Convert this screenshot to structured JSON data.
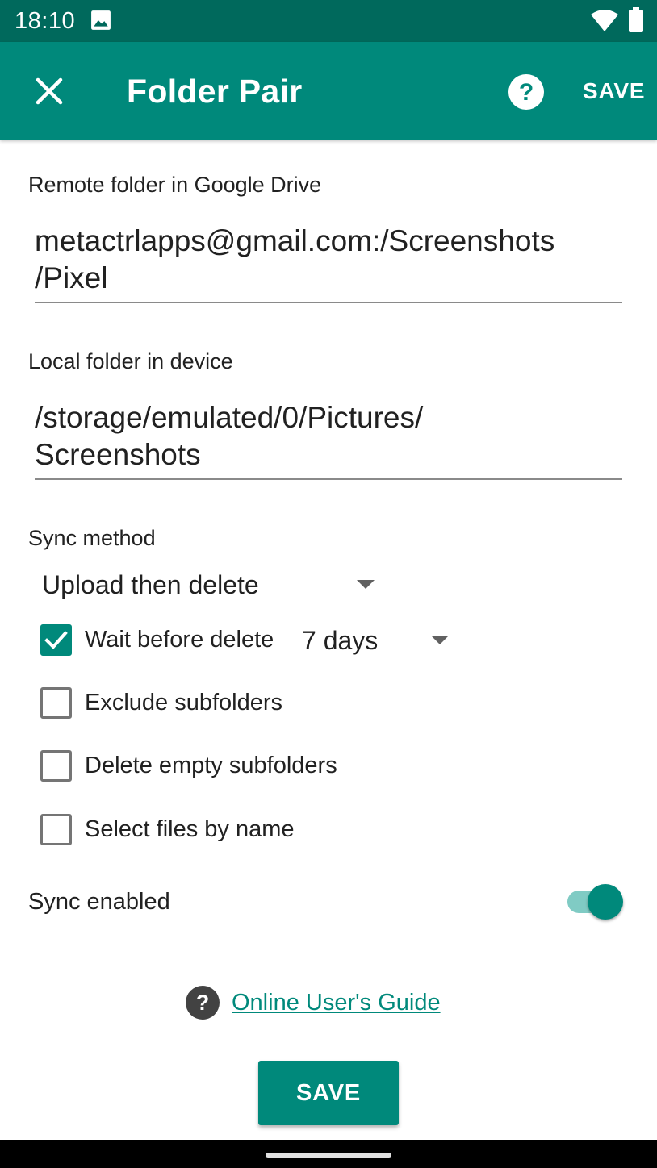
{
  "status_bar": {
    "time": "18:10",
    "icons": [
      "image-icon",
      "wifi-icon",
      "battery-icon"
    ]
  },
  "app_bar": {
    "close_icon": "close-icon",
    "title": "Folder Pair",
    "help_icon": "help-circle-icon",
    "save_label": "SAVE"
  },
  "remote_folder": {
    "label": "Remote folder in Google Drive",
    "value_line1": "metactrlapps@gmail.com:/Screenshots",
    "value_line2": "/Pixel"
  },
  "local_folder": {
    "label": "Local folder in device",
    "value_line1": "/storage/emulated/0/Pictures/",
    "value_line2": "Screenshots"
  },
  "sync_method": {
    "label": "Sync method",
    "selected": "Upload then delete"
  },
  "options": {
    "wait_before_delete": {
      "label": "Wait before delete",
      "checked": true,
      "delay_selected": "7 days"
    },
    "exclude_subfolders": {
      "label": "Exclude subfolders",
      "checked": false
    },
    "delete_empty_subfolders": {
      "label": "Delete empty subfolders",
      "checked": false
    },
    "select_files_by_name": {
      "label": "Select files by name",
      "checked": false
    }
  },
  "sync_enabled": {
    "label": "Sync enabled",
    "on": true
  },
  "guide": {
    "icon": "help-circle-icon",
    "link_text": "Online User's Guide"
  },
  "bottom": {
    "save_label": "SAVE"
  },
  "colors": {
    "status_bar": "#00695c",
    "primary": "#00897b",
    "toggle_track": "#80cbc4"
  }
}
